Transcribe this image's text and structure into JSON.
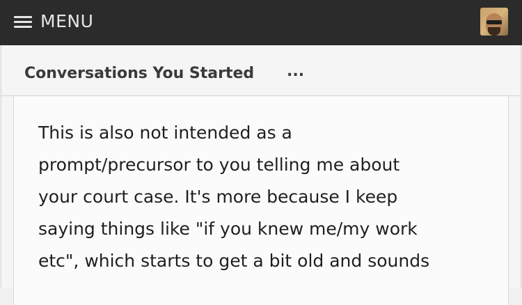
{
  "header": {
    "menu_label": "MENU",
    "avatar_alt": "user avatar"
  },
  "breadcrumb": {
    "title": "Conversations You Started",
    "more": "..."
  },
  "message": {
    "lines": [
      "This is also not intended as a",
      "prompt/precursor to you telling me about",
      "your court case. It's more because I keep",
      "saying things like \"if you knew me/my work",
      "etc\", which starts to get a bit old and sounds"
    ]
  },
  "colors": {
    "topbar": "#2b2b2b",
    "topbar_text": "#e6e6e6",
    "panel_bg": "#f5f5f5",
    "message_bg": "#fbfbfb",
    "text": "#1f1f1f"
  }
}
